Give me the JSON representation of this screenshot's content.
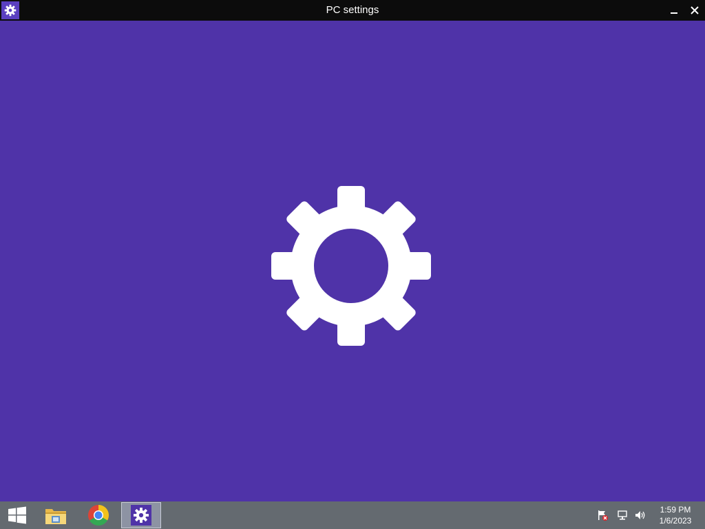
{
  "window": {
    "title": "PC settings",
    "app_icon": "gear-icon",
    "controls": [
      "minimize-icon",
      "close-icon"
    ]
  },
  "splash": {
    "icon": "gear-icon"
  },
  "colors": {
    "accent": "#4f33a8",
    "titlebar": "#0c0c0c",
    "taskbar": "#646a70",
    "foreground": "#ffffff"
  },
  "taskbar": {
    "items": [
      {
        "icon": "windows-start-icon"
      },
      {
        "icon": "file-explorer-icon"
      },
      {
        "icon": "chrome-icon"
      },
      {
        "icon": "settings-gear-icon",
        "active": true
      }
    ],
    "tray": {
      "icons": [
        "action-center-flag-icon",
        "network-icon",
        "volume-icon"
      ],
      "time": "1:59 PM",
      "date": "1/6/2023"
    }
  }
}
